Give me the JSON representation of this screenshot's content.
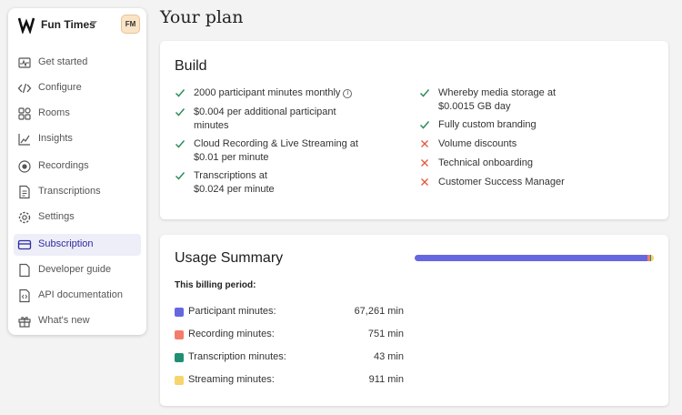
{
  "sidebar": {
    "team_name": "Fun Times",
    "avatar": "FM",
    "items": [
      {
        "label": "Get started",
        "icon": "activity-chart-icon"
      },
      {
        "label": "Configure",
        "icon": "code-icon"
      },
      {
        "label": "Rooms",
        "icon": "grid-icon"
      },
      {
        "label": "Insights",
        "icon": "line-chart-icon"
      },
      {
        "label": "Recordings",
        "icon": "record-icon"
      },
      {
        "label": "Transcriptions",
        "icon": "document-icon"
      },
      {
        "label": "Settings",
        "icon": "gear-icon"
      },
      {
        "label": "Subscription",
        "icon": "credit-card-icon",
        "active": true
      },
      {
        "label": "Developer guide",
        "icon": "file-icon"
      },
      {
        "label": "API documentation",
        "icon": "api-doc-icon"
      },
      {
        "label": "What's new",
        "icon": "gift-icon"
      }
    ]
  },
  "page": {
    "title": "Your plan"
  },
  "build": {
    "title": "Build",
    "features_left": [
      {
        "lines": [
          "2000 participant minutes monthly"
        ],
        "included": true,
        "info": true
      },
      {
        "lines": [
          "$0.004 per additional participant",
          "minutes"
        ],
        "included": true
      },
      {
        "lines": [
          "Cloud Recording & Live Streaming at",
          "$0.01 per minute"
        ],
        "included": true
      },
      {
        "lines": [
          "Transcriptions at",
          "$0.024 per minute"
        ],
        "included": true
      }
    ],
    "features_right": [
      {
        "lines": [
          "Whereby media storage at",
          "$0.0015 GB day"
        ],
        "included": true
      },
      {
        "lines": [
          "Fully custom branding"
        ],
        "included": true
      },
      {
        "lines": [
          "Volume discounts"
        ],
        "included": false
      },
      {
        "lines": [
          "Technical onboarding"
        ],
        "included": false
      },
      {
        "lines": [
          "Customer Success Manager"
        ],
        "included": false
      }
    ]
  },
  "usage": {
    "title": "Usage Summary",
    "billing_label": "This billing period:",
    "rows": [
      {
        "name": "Participant minutes:",
        "value": "67,261 min",
        "minutes": 67261,
        "color": "#6667e0"
      },
      {
        "name": "Recording minutes:",
        "value": "751 min",
        "minutes": 751,
        "color": "#f47c6b"
      },
      {
        "name": "Transcription minutes:",
        "value": "43 min",
        "minutes": 43,
        "color": "#1f8f72"
      },
      {
        "name": "Streaming minutes:",
        "value": "911 min",
        "minutes": 911,
        "color": "#f7d56c"
      }
    ]
  },
  "colors": {
    "accent": "#2d2ba0",
    "check": "#2f8c5e",
    "cross": "#e0583a"
  }
}
